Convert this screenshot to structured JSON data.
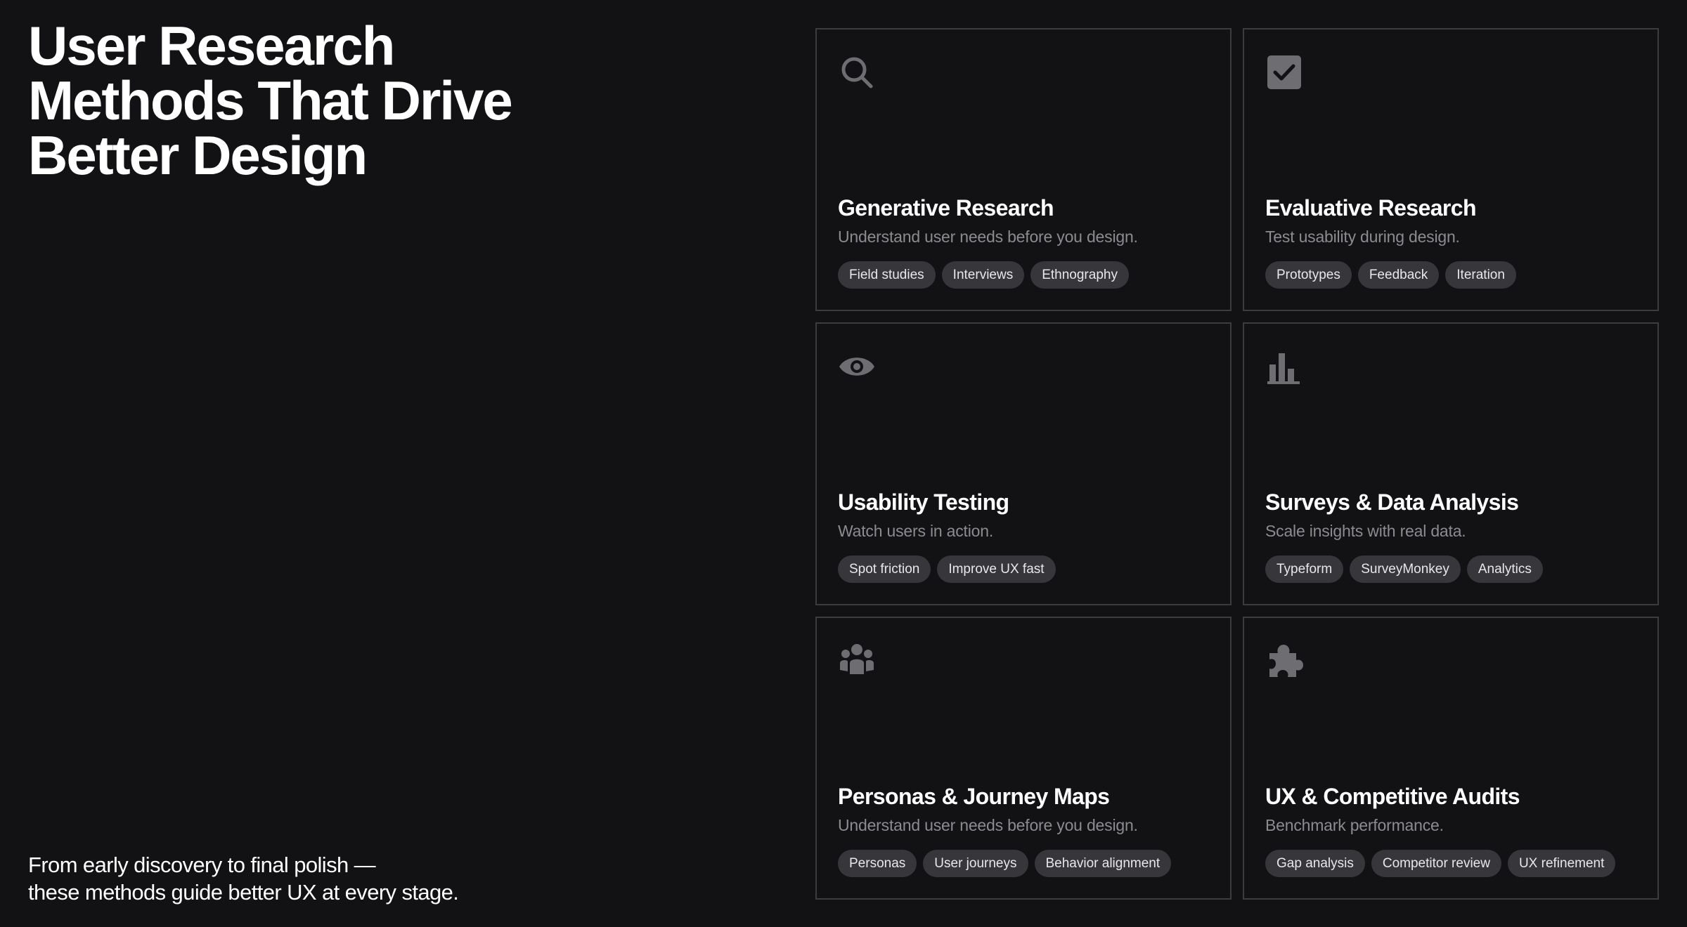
{
  "headline": {
    "lines": [
      "User Research",
      "Methods That Drive",
      "Better Design"
    ]
  },
  "tagline": {
    "lines": [
      "From early discovery to final polish —",
      "these methods guide better UX at every stage."
    ]
  },
  "colors": {
    "background": "#121114",
    "card_border": "#3c3b40",
    "tag_background": "#37363b",
    "icon": "#6e6d72",
    "description": "#8c8b90"
  },
  "cards": [
    {
      "icon": "search-icon",
      "title": "Generative Research",
      "description": "Understand user needs before you design.",
      "tags": [
        "Field studies",
        "Interviews",
        "Ethnography"
      ]
    },
    {
      "icon": "checkbox-icon",
      "title": "Evaluative Research",
      "description": "Test usability during design.",
      "tags": [
        "Prototypes",
        "Feedback",
        "Iteration"
      ]
    },
    {
      "icon": "eye-icon",
      "title": "Usability Testing",
      "description": "Watch users in action.",
      "tags": [
        "Spot friction",
        "Improve UX fast"
      ]
    },
    {
      "icon": "bar-chart-icon",
      "title": "Surveys & Data Analysis",
      "description": "Scale insights with real data.",
      "tags": [
        "Typeform",
        "SurveyMonkey",
        "Analytics"
      ]
    },
    {
      "icon": "group-icon",
      "title": "Personas & Journey Maps",
      "description": "Understand user needs before you design.",
      "tags": [
        "Personas",
        "User journeys",
        "Behavior alignment"
      ]
    },
    {
      "icon": "puzzle-icon",
      "title": "UX & Competitive Audits",
      "description": "Benchmark performance.",
      "tags": [
        "Gap analysis",
        "Competitor review",
        "UX refinement"
      ]
    }
  ]
}
